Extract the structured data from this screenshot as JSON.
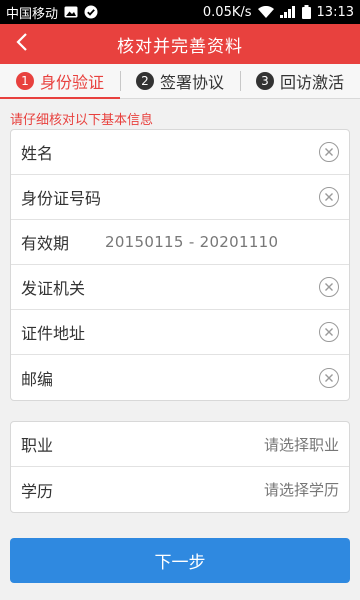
{
  "status_bar": {
    "carrier": "中国移动",
    "speed": "0.05K/s",
    "time": "13:13",
    "icons": [
      "image-icon",
      "check-icon",
      "wifi-icon",
      "signal-icon",
      "battery-icon"
    ]
  },
  "header": {
    "title": "核对并完善资料",
    "back_icon": "chevron-left-icon",
    "background": "#e8413e"
  },
  "steps": [
    {
      "num": "1",
      "label": "身份验证",
      "active": true
    },
    {
      "num": "2",
      "label": "签署协议",
      "active": false
    },
    {
      "num": "3",
      "label": "回访激活",
      "active": false
    }
  ],
  "hint": "请仔细核对以下基本信息",
  "identity_fields": [
    {
      "label": "姓名",
      "value": "",
      "clearable": true
    },
    {
      "label": "身份证号码",
      "value": "",
      "clearable": true
    },
    {
      "label": "有效期",
      "value": "20150115 - 20201110",
      "clearable": false
    },
    {
      "label": "发证机关",
      "value": "",
      "clearable": true
    },
    {
      "label": "证件地址",
      "value": "",
      "clearable": true
    },
    {
      "label": "邮编",
      "value": "",
      "clearable": true
    }
  ],
  "select_fields": [
    {
      "label": "职业",
      "placeholder": "请选择职业"
    },
    {
      "label": "学历",
      "placeholder": "请选择学历"
    }
  ],
  "next_button": {
    "label": "下一步",
    "color": "#2f89e0"
  }
}
